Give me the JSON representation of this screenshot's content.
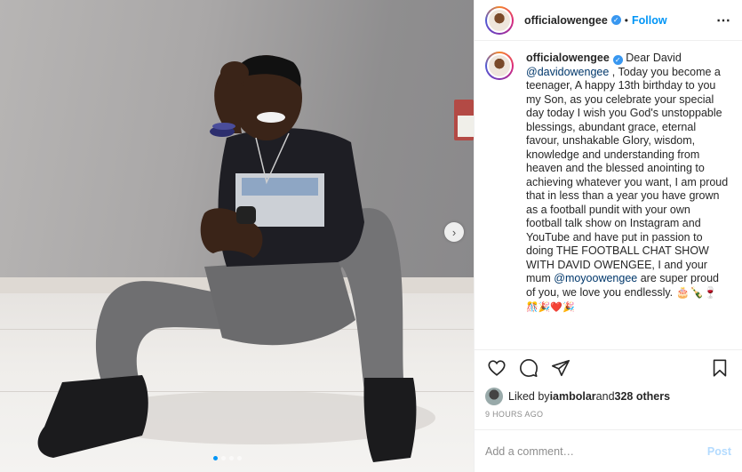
{
  "post": {
    "username": "officialowengee",
    "separator": "•",
    "follow_label": "Follow",
    "more_icon": "more-options-icon",
    "caption": {
      "username": "officialowengee",
      "intro": " Dear David",
      "mention1": "@davidowengee",
      "body1": " , Today you become a teenager, A happy 13th birthday to you my Son, as you celebrate your special day today I wish you God's unstoppable blessings, abundant grace, eternal favour, unshakable Glory, wisdom, knowledge and understanding from heaven and the blessed anointing to achieving whatever you want, I am proud that in less than a year you have grown as a football pundit with your own football talk show on Instagram and YouTube and have put in passion to doing THE FOOTBALL CHAT SHOW WITH DAVID OWENGEE, I and your mum ",
      "mention2": "@moyoowengee",
      "body2": " are super proud of you, we love you endlessly. 🎂🍾🍷",
      "emoji_row": "🎊🎉❤️🎉"
    },
    "likes": {
      "prefix": "Liked by ",
      "liker": "iambolar",
      "middle": " and ",
      "count": "328 others"
    },
    "timestamp": "9 HOURS AGO",
    "comment_input": {
      "placeholder": "Add a comment…",
      "value": ""
    },
    "post_button_label": "Post",
    "carousel": {
      "total_slides": 4,
      "active_slide": 1,
      "next_icon": "chevron-right-icon"
    }
  },
  "colors": {
    "accent": "#0095f6",
    "verified": "#3897f0",
    "mention": "#00376b",
    "muted": "#8e8e8e",
    "post_disabled": "#b3dbff"
  }
}
